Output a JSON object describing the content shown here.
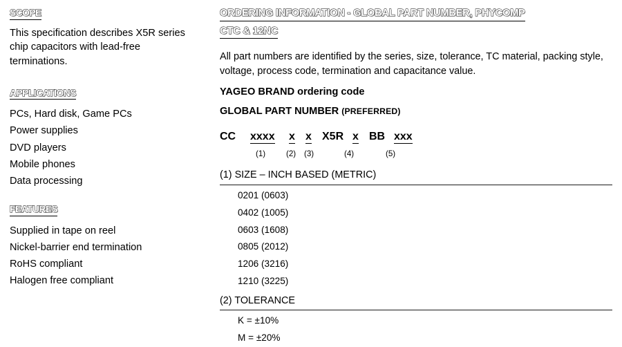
{
  "left": {
    "scope": {
      "heading": "SCOPE",
      "text": "This specification describes X5R series chip capacitors with lead-free terminations."
    },
    "applications": {
      "heading": "APPLICATIONS",
      "items": [
        "PCs, Hard disk, Game PCs",
        "Power supplies",
        "DVD players",
        "Mobile phones",
        "Data processing"
      ]
    },
    "features": {
      "heading": "FEATURES",
      "items": [
        "Supplied in tape on reel",
        "Nickel-barrier end termination",
        "RoHS compliant",
        "Halogen free compliant"
      ]
    }
  },
  "right": {
    "title_line1": "ORDERING INFORMATION - GLOBAL PART NUMBER, PHYCOMP",
    "title_line2": "CTC & 12NC",
    "intro": "All part numbers are identified by the series, size, tolerance, TC material, packing style, voltage, process code, termination and capacitance value.",
    "yageo_line": "YAGEO BRAND ordering code",
    "global_line_main": "GLOBAL PART NUMBER ",
    "global_line_suffix": "(PREFERRED)",
    "code": {
      "segments": [
        {
          "text": "CC",
          "underlined": false
        },
        {
          "text": "xxxx",
          "underlined": true
        },
        {
          "text": "x",
          "underlined": true
        },
        {
          "text": "x",
          "underlined": true
        },
        {
          "text": "X5R",
          "underlined": false
        },
        {
          "text": "x",
          "underlined": true
        },
        {
          "text": "BB",
          "underlined": false
        },
        {
          "text": "xxx",
          "underlined": true
        }
      ],
      "annotations": [
        "(1)",
        "(2)",
        "(3)",
        "(4)",
        "(5)"
      ]
    },
    "tables": [
      {
        "heading": "(1) SIZE – INCH BASED (METRIC)",
        "rows": [
          "0201 (0603)",
          "0402 (1005)",
          "0603 (1608)",
          "0805 (2012)",
          "1206 (3216)",
          "1210 (3225)"
        ]
      },
      {
        "heading": "(2) TOLERANCE",
        "rows": [
          "K = ±10%",
          "M = ±20%"
        ]
      }
    ]
  }
}
